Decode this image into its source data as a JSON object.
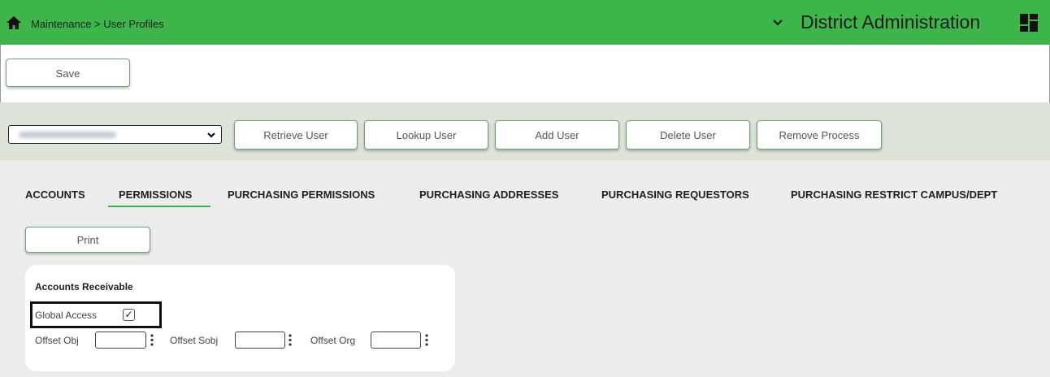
{
  "header": {
    "breadcrumb": "Maintenance > User Profiles",
    "app_title": "District Administration",
    "icons": [
      "home-icon",
      "chevron-down-icon",
      "dashboard-grid-icon"
    ],
    "colors": {
      "header_bg": "#3db54a",
      "panel_bg": "#dde3d8",
      "content_bg": "#ededed"
    }
  },
  "toolbar": {
    "save_label": "Save"
  },
  "user_panel": {
    "selected_user": "",
    "buttons": {
      "retrieve": "Retrieve User",
      "lookup": "Lookup User",
      "add": "Add User",
      "delete": "Delete User",
      "remove_process": "Remove Process"
    }
  },
  "tabs": [
    {
      "label": "ACCOUNTS",
      "active": false
    },
    {
      "label": "PERMISSIONS",
      "active": true
    },
    {
      "label": "PURCHASING PERMISSIONS",
      "active": false
    },
    {
      "label": "PURCHASING ADDRESSES",
      "active": false
    },
    {
      "label": "PURCHASING REQUESTORS",
      "active": false
    },
    {
      "label": "PURCHASING RESTRICT CAMPUS/DEPT",
      "active": false
    }
  ],
  "print_label": "Print",
  "permissions": {
    "section_title": "Accounts Receivable",
    "global_access": {
      "label": "Global Access",
      "checked": true,
      "mark": "✓"
    },
    "fields": [
      {
        "label": "Offset Obj",
        "value": ""
      },
      {
        "label": "Offset Sobj",
        "value": ""
      },
      {
        "label": "Offset Org",
        "value": ""
      }
    ]
  }
}
